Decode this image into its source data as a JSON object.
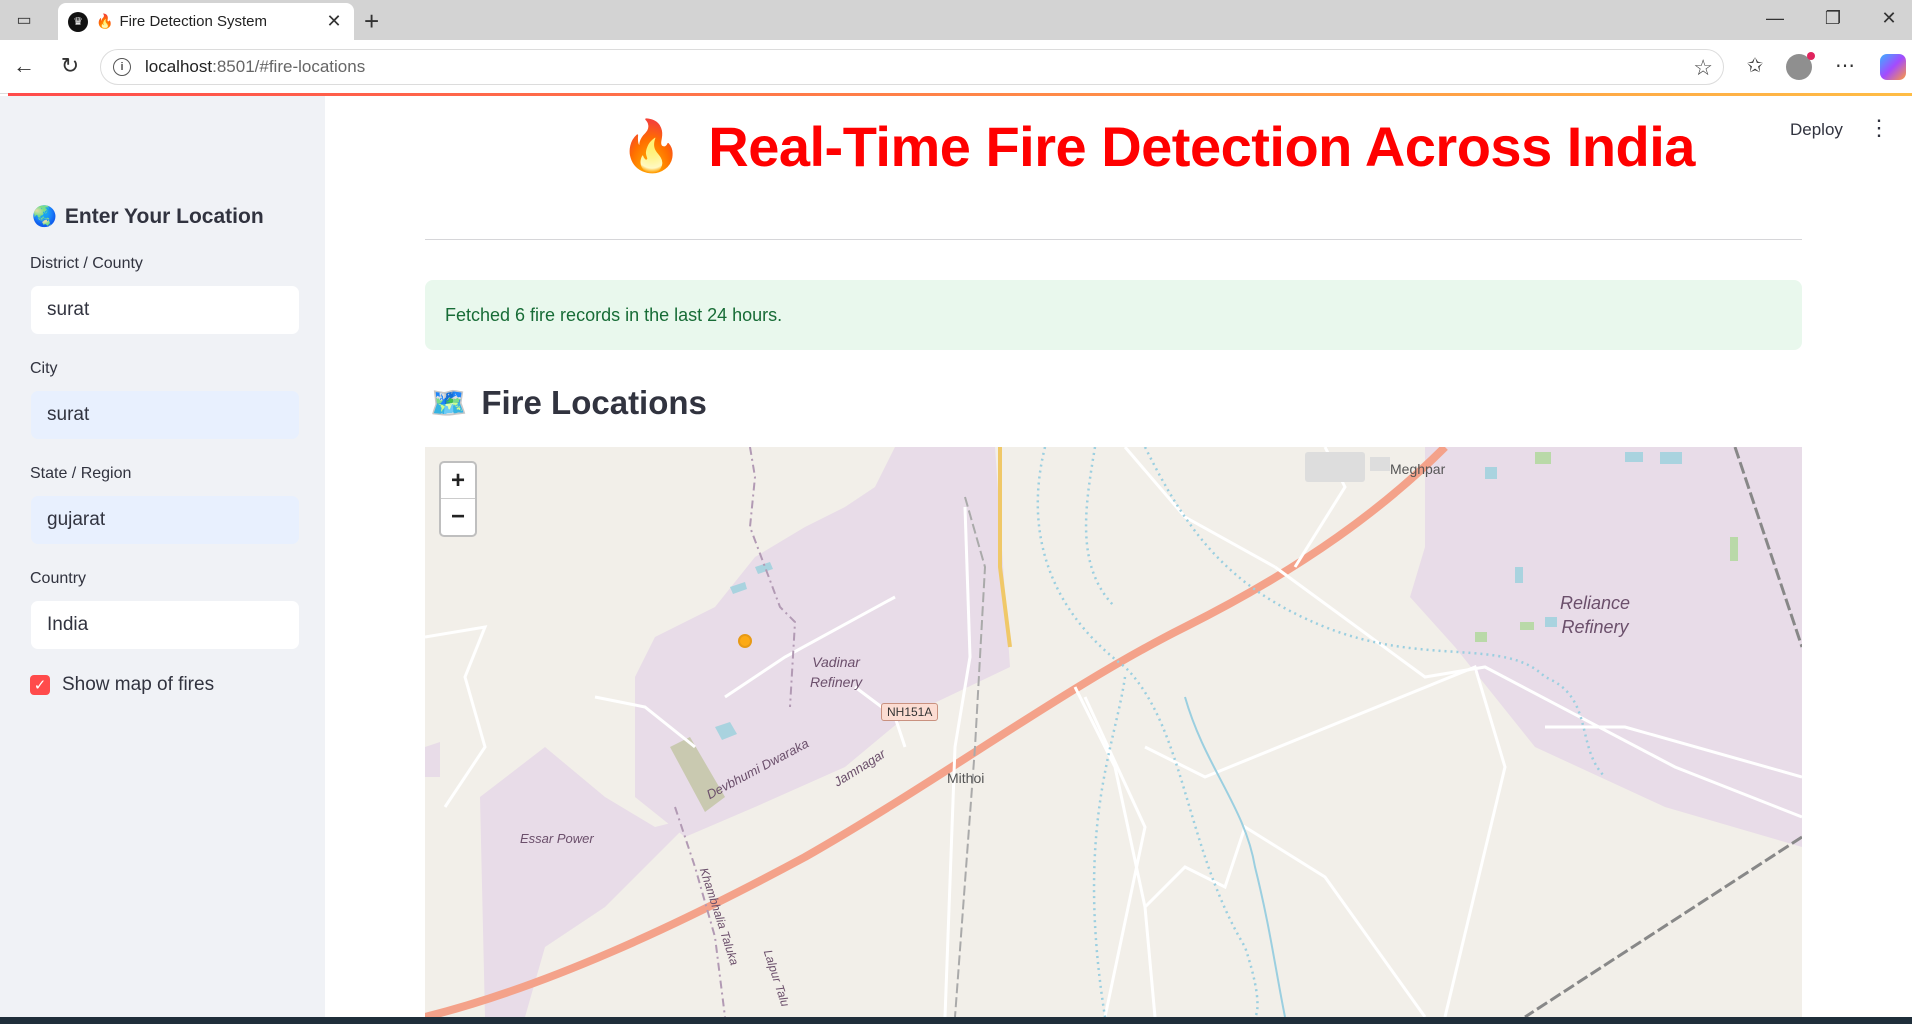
{
  "browser": {
    "tab_title": "Fire Detection System",
    "url_host": "localhost",
    "url_path": ":8501/#fire-locations"
  },
  "app": {
    "deploy_label": "Deploy",
    "title": "Real-Time Fire Detection Across India",
    "title_icon": "🔥",
    "success_message": "Fetched 6 fire records in the last 24 hours.",
    "map_section_title": "Fire Locations",
    "map_section_icon": "🗺️"
  },
  "sidebar": {
    "header": "Enter Your Location",
    "header_icon": "🌏",
    "fields": [
      {
        "label": "District / County",
        "value": "surat"
      },
      {
        "label": "City",
        "value": "surat"
      },
      {
        "label": "State / Region",
        "value": "gujarat"
      },
      {
        "label": "Country",
        "value": "India"
      }
    ],
    "show_map_label": "Show map of fires",
    "show_map_checked": true
  },
  "map": {
    "zoom_in": "+",
    "zoom_out": "−",
    "labels": {
      "meghpar": "Meghpar",
      "reliance_1": "Reliance",
      "reliance_2": "Refinery",
      "vadinar_1": "Vadinar",
      "vadinar_2": "Refinery",
      "nh": "NH151A",
      "mithoi": "Mithoi",
      "essar": "Essar Power",
      "devbhumi": "Devbhumi Dwaraka",
      "jamnagar": "Jamnagar",
      "khambhalia": "Khambhalia Taluka",
      "lalpur": "Lalpur Talu"
    },
    "fire_points": 1
  },
  "colors": {
    "accent": "#ff4b4b",
    "title": "#ff0000",
    "success_bg": "#e9f8ed",
    "success_text": "#176c36",
    "fire_marker": "#ffa500"
  }
}
